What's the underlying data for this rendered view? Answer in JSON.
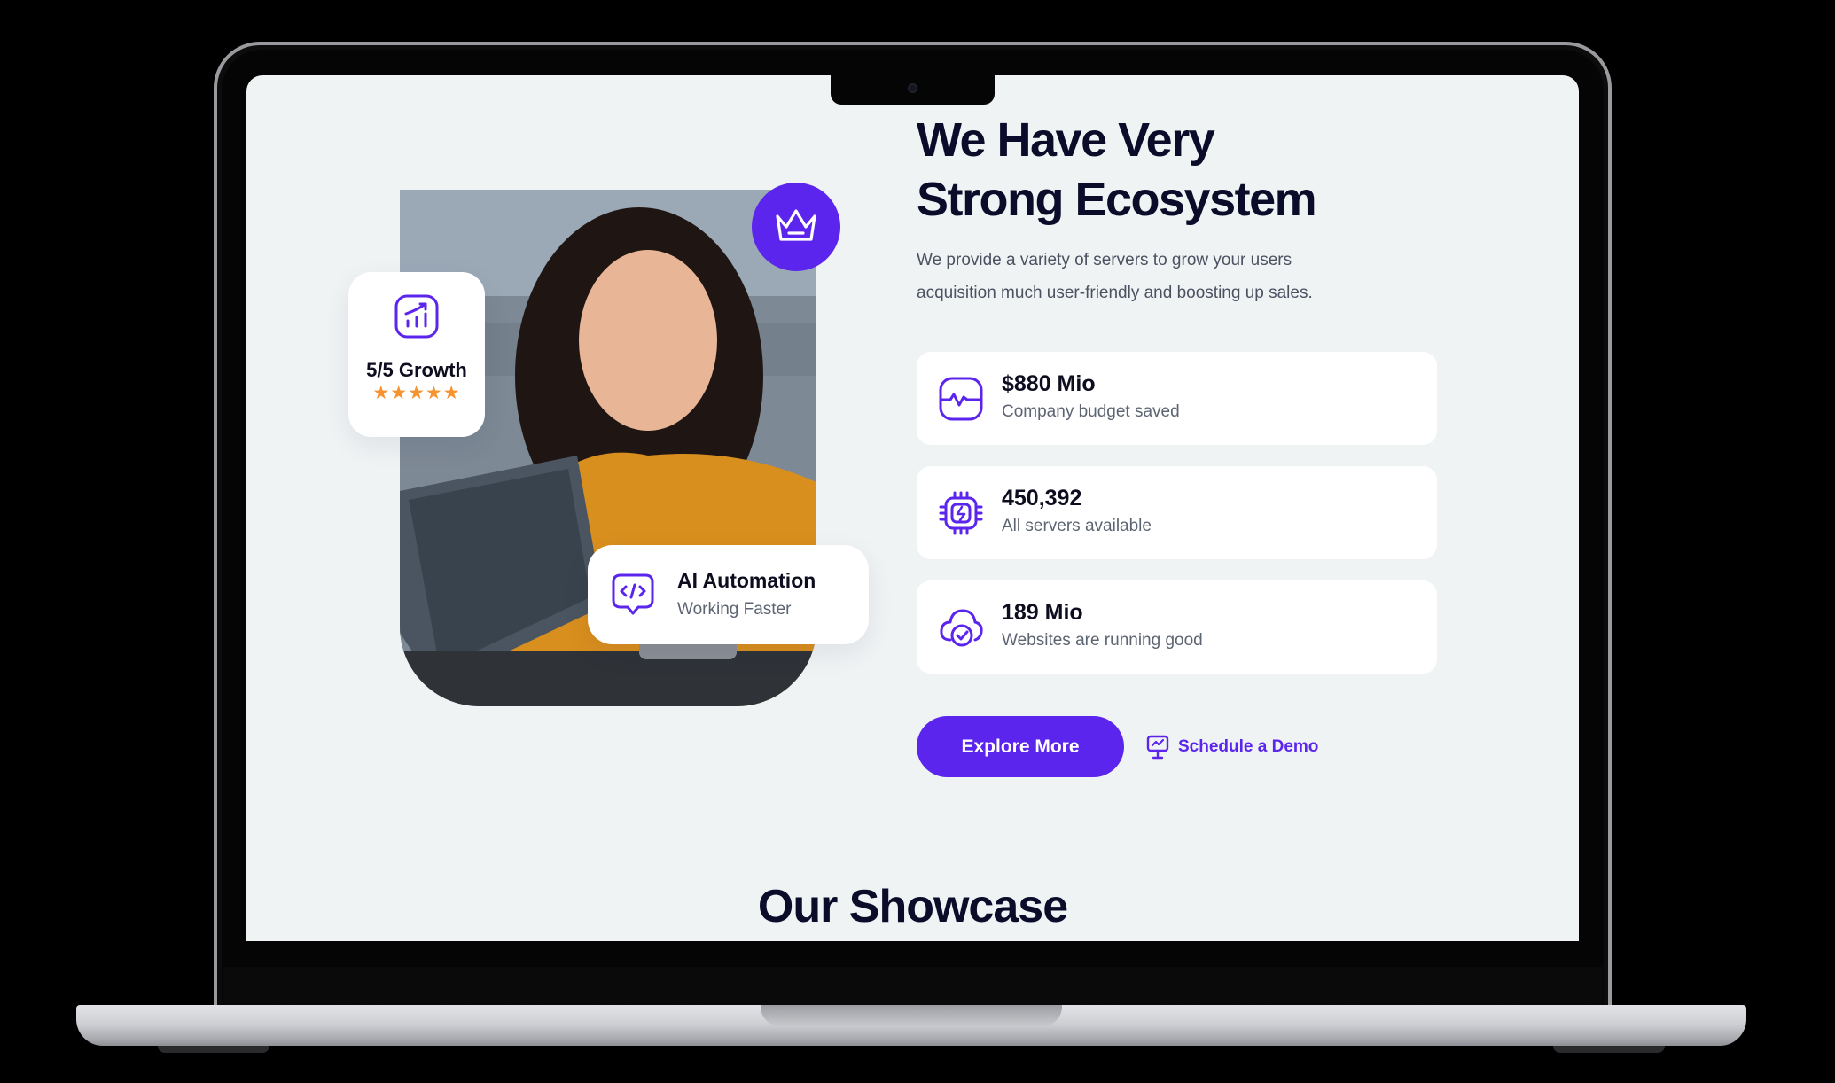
{
  "hero": {
    "headline_line1": "We Have Very",
    "headline_line2": "Strong Ecosystem",
    "lead_line1": "We provide a variety of servers to grow your users",
    "lead_line2": "acquisition much user-friendly and boosting up sales."
  },
  "growth_card": {
    "title": "5/5 Growth",
    "stars": "★★★★★",
    "rating": 5,
    "icon": "chart-up-icon"
  },
  "ai_card": {
    "title": "AI Automation",
    "subtitle": "Working Faster",
    "icon": "code-chat-icon"
  },
  "badge": {
    "icon": "crown-icon"
  },
  "stats": [
    {
      "value": "$880 Mio",
      "label": "Company budget saved",
      "icon": "pulse-monitor-icon"
    },
    {
      "value": "450,392",
      "label": "All servers available",
      "icon": "chip-icon"
    },
    {
      "value": "189 Mio",
      "label": "Websites are running good",
      "icon": "cloud-check-icon"
    }
  ],
  "actions": {
    "explore": "Explore More",
    "demo": "Schedule a Demo",
    "demo_icon": "presentation-icon"
  },
  "showcase": {
    "title": "Our Showcase"
  },
  "colors": {
    "accent": "#5c25ee",
    "heading": "#0b0b2a",
    "background": "#f0f3f4",
    "star": "#f7922e"
  }
}
